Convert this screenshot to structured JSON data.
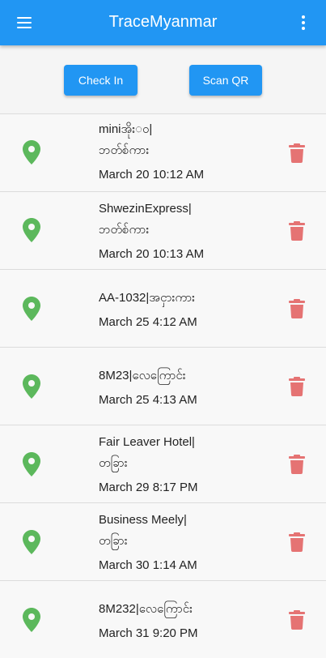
{
  "app_bar": {
    "title": "TraceMyanmar",
    "menu_icon": "hamburger-menu-icon",
    "more_icon": "more-vert-icon",
    "color": "#2196f3"
  },
  "actions": {
    "check_in_label": "Check In",
    "scan_qr_label": "Scan QR"
  },
  "colors": {
    "pin": "#5cb85c",
    "trash": "#e57373"
  },
  "entries": [
    {
      "place_line1": "miniအိုး◌ဝ|",
      "place_line2": "ဘတ်စ်ကား",
      "datetime": "March 20 10:12 AM"
    },
    {
      "place_line1": "ShwezinExpress|",
      "place_line2": "ဘတ်စ်ကား",
      "datetime": "March 20 10:13 AM"
    },
    {
      "place_line1": "AA-1032|အငှားကား",
      "place_line2": "",
      "datetime": "March 25 4:12 AM"
    },
    {
      "place_line1": "8M23|လေကြောင်း",
      "place_line2": "",
      "datetime": "March 25 4:13 AM"
    },
    {
      "place_line1": "Fair Leaver Hotel|",
      "place_line2": "တခြား",
      "datetime": "March 29 8:17 PM"
    },
    {
      "place_line1": "Business Meely|",
      "place_line2": "တခြား",
      "datetime": "March 30 1:14 AM"
    },
    {
      "place_line1": "8M232|လေကြောင်း",
      "place_line2": "",
      "datetime": "March 31 9:20 PM"
    }
  ]
}
